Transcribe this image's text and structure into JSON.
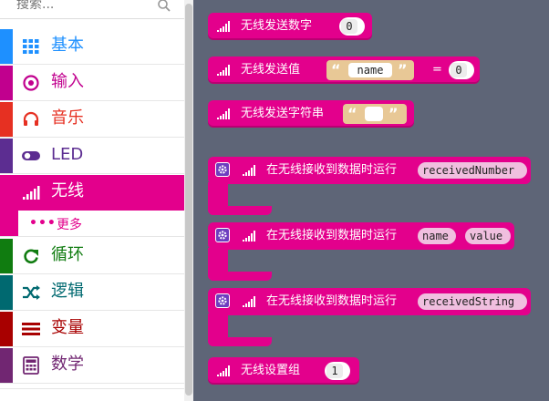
{
  "search": {
    "placeholder": "搜索..."
  },
  "categories": [
    {
      "label": "基本",
      "color": "#1e90ff",
      "icon": "grid-icon"
    },
    {
      "label": "输入",
      "color": "#c1008e",
      "icon": "radio-target-icon"
    },
    {
      "label": "音乐",
      "color": "#e63022",
      "icon": "headphones-icon"
    },
    {
      "label": "LED",
      "color": "#5c2d91",
      "icon": "toggle-icon"
    },
    {
      "label": "无线",
      "color": "#e3008c",
      "icon": "signal-bars-icon"
    },
    {
      "label": "循环",
      "color": "#107c10",
      "icon": "refresh-icon"
    },
    {
      "label": "逻辑",
      "color": "#006970",
      "icon": "shuffle-icon"
    },
    {
      "label": "变量",
      "color": "#a80000",
      "icon": "list-lines-icon"
    },
    {
      "label": "数学",
      "color": "#712672",
      "icon": "calculator-icon"
    }
  ],
  "more": {
    "label": "更多",
    "dots": "•••"
  },
  "blocks": {
    "send_number": {
      "label": "无线发送数字",
      "value": "0"
    },
    "send_value": {
      "label": "无线发送值",
      "name": "name",
      "equals": "=",
      "value": "0",
      "lq": "“",
      "rq": "”"
    },
    "send_string": {
      "label": "无线发送字符串",
      "value": "",
      "lq": "“",
      "rq": "”"
    },
    "on_number": {
      "label": "在无线接收到数据时运行",
      "var": "receivedNumber"
    },
    "on_value": {
      "label": "在无线接收到数据时运行",
      "var1": "name",
      "var2": "value"
    },
    "on_string": {
      "label": "在无线接收到数据时运行",
      "var": "receivedString"
    },
    "set_group": {
      "label": "无线设置组",
      "value": "1"
    }
  },
  "colors": {
    "radio": "#e3008c",
    "workspace": "#5e6577",
    "string": "#e8c896",
    "gear": "#6d3dbf"
  }
}
